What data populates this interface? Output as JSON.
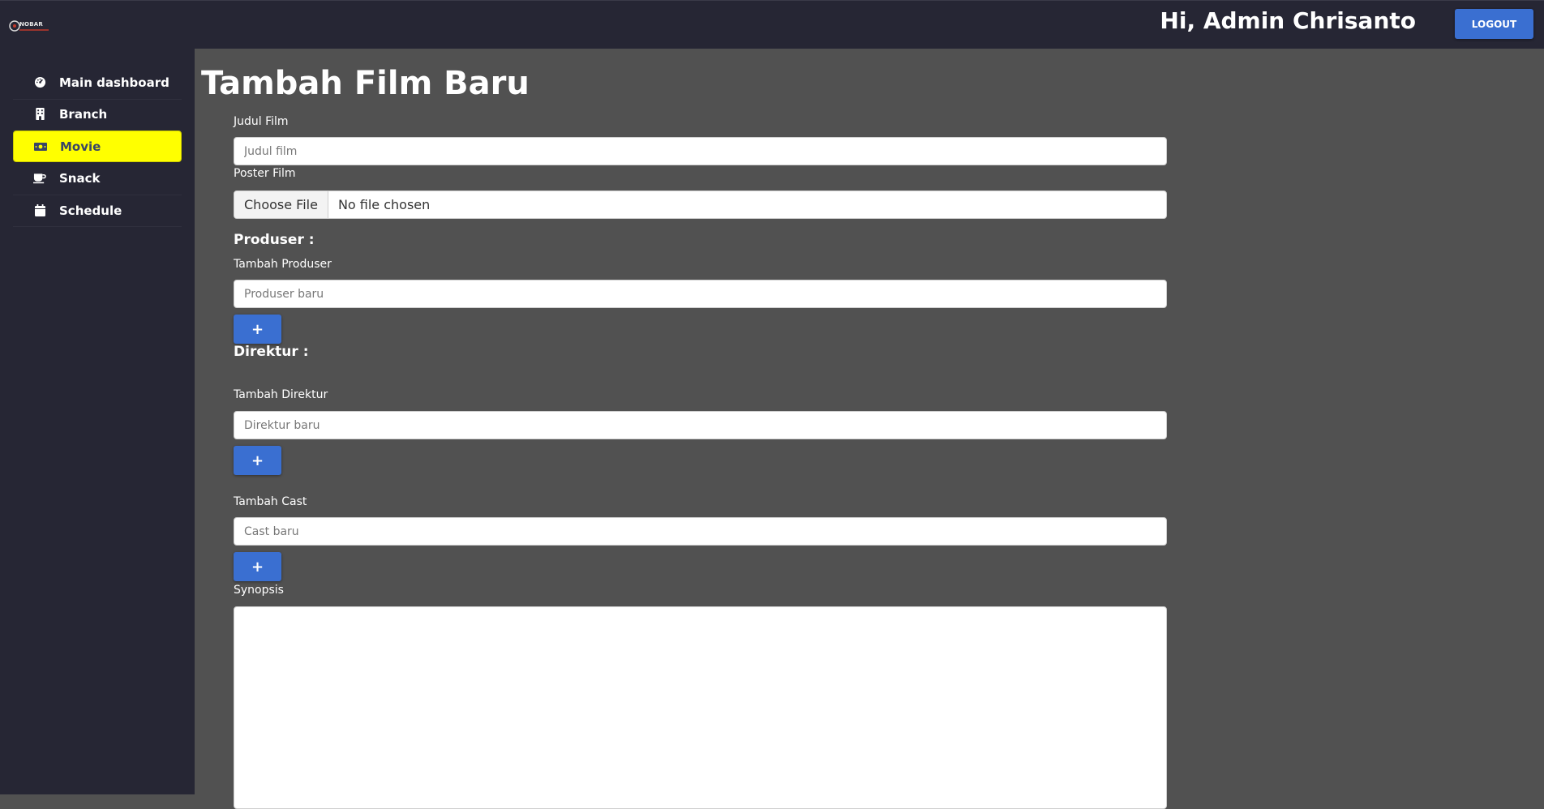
{
  "header": {
    "logo_text": "NOBAR",
    "greeting": "Hi, Admin Chrisanto",
    "logout_label": "LOGOUT"
  },
  "sidebar": {
    "items": [
      {
        "label": "Main dashboard",
        "icon": "gauge-icon",
        "active": false
      },
      {
        "label": "Branch",
        "icon": "building-icon",
        "active": false
      },
      {
        "label": "Movie",
        "icon": "money-bill-icon",
        "active": true
      },
      {
        "label": "Snack",
        "icon": "coffee-cup-icon",
        "active": false
      },
      {
        "label": "Schedule",
        "icon": "calendar-icon",
        "active": false
      }
    ],
    "active_color": "#ffff00"
  },
  "main": {
    "title": "Tambah Film Baru",
    "judul": {
      "label": "Judul Film",
      "placeholder": "Judul film",
      "value": ""
    },
    "poster": {
      "label": "Poster Film",
      "button": "Choose File",
      "status": "No file chosen"
    },
    "produser": {
      "section": "Produser :",
      "label": "Tambah Produser",
      "placeholder": "Produser baru",
      "add_label": "+"
    },
    "direktur": {
      "section": "Direktur :",
      "label": "Tambah Direktur",
      "placeholder": "Direktur baru",
      "add_label": "+"
    },
    "cast": {
      "label": "Tambah Cast",
      "placeholder": "Cast baru",
      "add_label": "+"
    },
    "synopsis": {
      "label": "Synopsis",
      "value": ""
    }
  },
  "colors": {
    "accent": "#3a6fd1",
    "sidebar_bg": "#262634",
    "content_bg": "#515151"
  }
}
